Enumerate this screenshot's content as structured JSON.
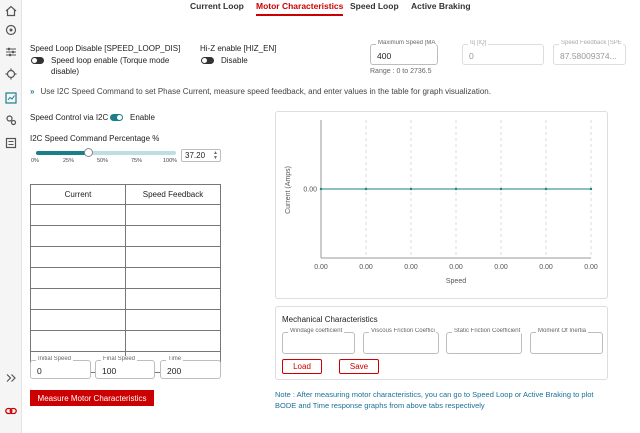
{
  "tabs": [
    "Current Loop",
    "Motor Characteristics",
    "Speed Loop",
    "Active Braking"
  ],
  "speed_loop_disable": {
    "title": "Speed Loop Disable [SPEED_LOOP_DIS]",
    "toggle_label_line1": "Speed loop enable (Torque mode",
    "toggle_label_line2": "disable)",
    "enabled": false
  },
  "hiz": {
    "title": "Hi-Z enable [HIZ_EN]",
    "toggle_label": "Disable",
    "enabled": false
  },
  "max_speed": {
    "legend": "Maximum Speed [MAX",
    "value": "400",
    "range": "Range : 0 to 2736.5"
  },
  "iq": {
    "legend": "Iq [IQ]",
    "value": "0"
  },
  "speed_feedback": {
    "legend": "Speed Feedback [SPE",
    "value": "87.58009374..."
  },
  "info": "Use I2C Speed Command to set Phase Current, measure speed feedback, and enter values in the table for graph visualization.",
  "i2c": {
    "label": "Speed Control via I2C",
    "toggle_label": "Enable",
    "enabled": true
  },
  "slider": {
    "label": "I2C Speed Command Percentage %",
    "value_percent": 37.2,
    "display": "37.20",
    "ticks": [
      "0%",
      "25%",
      "50%",
      "75%",
      "100%"
    ]
  },
  "table": {
    "headers": [
      "Current",
      "Speed Feedback"
    ],
    "rows": 8
  },
  "initial_speed": {
    "legend": "Initial Speed",
    "value": "0"
  },
  "final_speed": {
    "legend": "Final Speed",
    "value": "100"
  },
  "time": {
    "legend": "Time",
    "value": "200"
  },
  "measure_button": "Measure Motor Characteristics",
  "chart_data": {
    "type": "line",
    "x": [
      "0.00",
      "0.00",
      "0.00",
      "0.00",
      "0.00",
      "0.00",
      "0.00"
    ],
    "series": [
      {
        "values": [
          0,
          0,
          0,
          0,
          0,
          0,
          0
        ]
      }
    ],
    "xlabel": "Speed",
    "ylabel": "Current (Amps)",
    "y_ticks": [
      "0.00"
    ],
    "grid": true,
    "line_color": "#1a7f8a"
  },
  "mech": {
    "title": "Mechanical Characteristics",
    "fields": [
      "Windage coefficient",
      "Viscous Friction Coeffici",
      "Static Friction Coefficient",
      "Moment Of Inertia"
    ],
    "load": "Load",
    "save": "Save"
  },
  "note": "Note : After measuring motor characteristics, you can go to Speed Loop or Active Braking to plot BODE and Time response graphs from above tabs respectively",
  "colors": {
    "accent": "#1a7f8a",
    "brand": "#cc0000"
  }
}
